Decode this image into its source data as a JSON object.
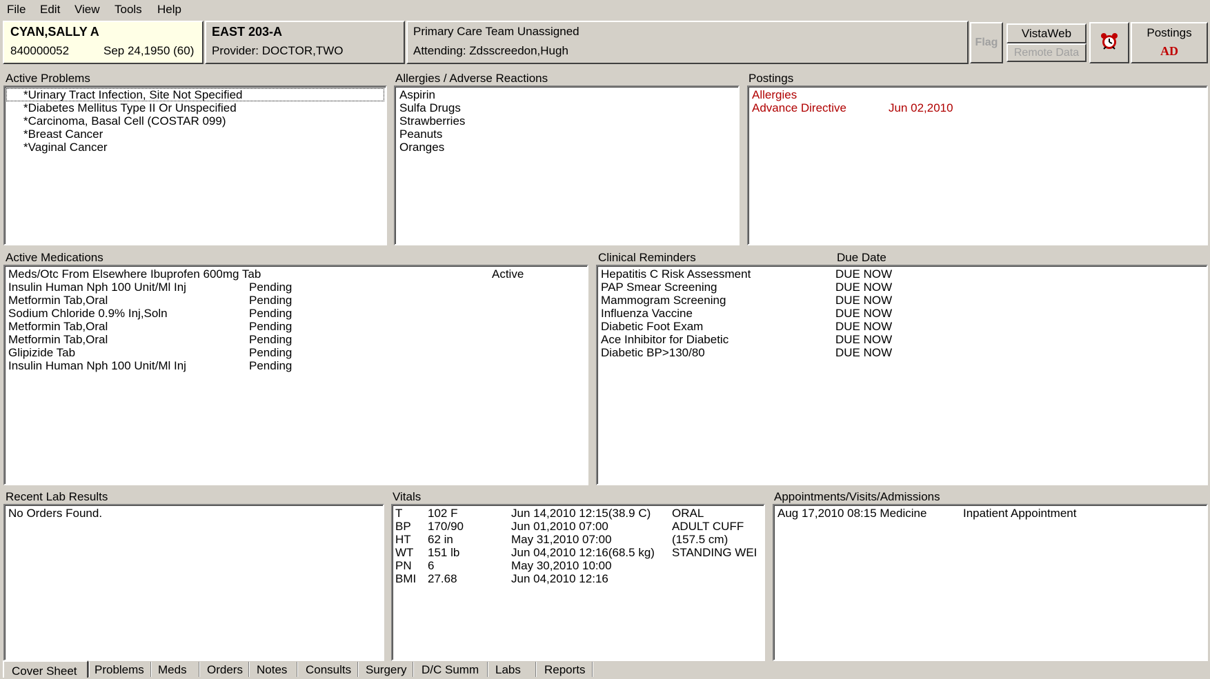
{
  "menu": [
    "File",
    "Edit",
    "View",
    "Tools",
    "Help"
  ],
  "patient": {
    "name": "CYAN,SALLY A",
    "id": "840000052",
    "dob": "Sep 24,1950 (60)"
  },
  "location": {
    "ward": "EAST 203-A",
    "provider": "Provider:  DOCTOR,TWO"
  },
  "team": {
    "line1": "Primary Care Team Unassigned",
    "line2": "Attending:  Zdsscreedon,Hugh"
  },
  "buttons": {
    "flag": "Flag",
    "vistaweb": "VistaWeb",
    "remote_data": "Remote Data",
    "postings": "Postings",
    "postings_code": "AD"
  },
  "active_problems": {
    "title": "Active Problems",
    "items": [
      "*Urinary Tract Infection, Site Not Specified",
      "*Diabetes Mellitus Type II Or Unspecified",
      "*Carcinoma, Basal Cell (COSTAR 099)",
      "*Breast Cancer",
      "*Vaginal Cancer"
    ]
  },
  "allergies": {
    "title": "Allergies / Adverse Reactions",
    "items": [
      "Aspirin",
      "Sulfa Drugs",
      "Strawberries",
      "Peanuts",
      "Oranges"
    ]
  },
  "postings": {
    "title": "Postings",
    "items": [
      {
        "label": "Allergies",
        "date": ""
      },
      {
        "label": "Advance Directive",
        "date": "Jun 02,2010"
      }
    ]
  },
  "medications": {
    "title": "Active Medications",
    "items": [
      {
        "name": "Meds/Otc From Elsewhere  Ibuprofen 600mg Tab",
        "pending": "",
        "status": "Active"
      },
      {
        "name": "Insulin Human Nph 100 Unit/Ml Inj",
        "pending": "Pending",
        "status": ""
      },
      {
        "name": "Metformin Tab,Oral",
        "pending": "Pending",
        "status": ""
      },
      {
        "name": "Sodium Chloride 0.9% Inj,Soln",
        "pending": "Pending",
        "status": ""
      },
      {
        "name": "Metformin Tab,Oral",
        "pending": "Pending",
        "status": ""
      },
      {
        "name": "Metformin Tab,Oral",
        "pending": "Pending",
        "status": ""
      },
      {
        "name": "Glipizide Tab",
        "pending": "Pending",
        "status": ""
      },
      {
        "name": "Insulin Human Nph 100 Unit/Ml Inj",
        "pending": "Pending",
        "status": ""
      }
    ]
  },
  "reminders": {
    "title": "Clinical Reminders",
    "due_title": "Due Date",
    "items": [
      {
        "name": "Hepatitis C Risk Assessment",
        "due": "DUE NOW"
      },
      {
        "name": "PAP Smear Screening",
        "due": "DUE NOW"
      },
      {
        "name": "Mammogram Screening",
        "due": "DUE NOW"
      },
      {
        "name": "Influenza Vaccine",
        "due": "DUE NOW"
      },
      {
        "name": "Diabetic Foot Exam",
        "due": "DUE NOW"
      },
      {
        "name": "Ace Inhibitor for Diabetic",
        "due": "DUE NOW"
      },
      {
        "name": "Diabetic BP>130/80",
        "due": "DUE NOW"
      }
    ]
  },
  "labs": {
    "title": "Recent Lab Results",
    "items": [
      "No Orders Found."
    ]
  },
  "vitals": {
    "title": "Vitals",
    "items": [
      {
        "code": "T",
        "value": "102 F",
        "date": "Jun 14,2010 12:15(38.9 C)",
        "note": "ORAL"
      },
      {
        "code": "BP",
        "value": "170/90",
        "date": "Jun 01,2010 07:00",
        "note": "ADULT CUFF"
      },
      {
        "code": "HT",
        "value": "62 in",
        "date": "May 31,2010 07:00",
        "note": "(157.5 cm)"
      },
      {
        "code": "WT",
        "value": "151 lb",
        "date": "Jun 04,2010 12:16(68.5 kg)",
        "note": "STANDING WEI"
      },
      {
        "code": "PN",
        "value": "6",
        "date": "May 30,2010 10:00",
        "note": ""
      },
      {
        "code": "BMI",
        "value": "27.68",
        "date": "Jun 04,2010 12:16",
        "note": ""
      }
    ]
  },
  "appointments": {
    "title": "Appointments/Visits/Admissions",
    "items": [
      {
        "date": "Aug 17,2010 08:15 Medicine",
        "type": "Inpatient Appointment"
      }
    ]
  },
  "tabs": [
    "Cover Sheet",
    "Problems",
    "Meds",
    "Orders",
    "Notes",
    "Consults",
    "Surgery",
    "D/C Summ",
    "Labs",
    "Reports"
  ],
  "colors": {
    "window_bg": "#d4d0c8",
    "patient_bg": "#ffffe6",
    "alert_red": "#b00000"
  }
}
